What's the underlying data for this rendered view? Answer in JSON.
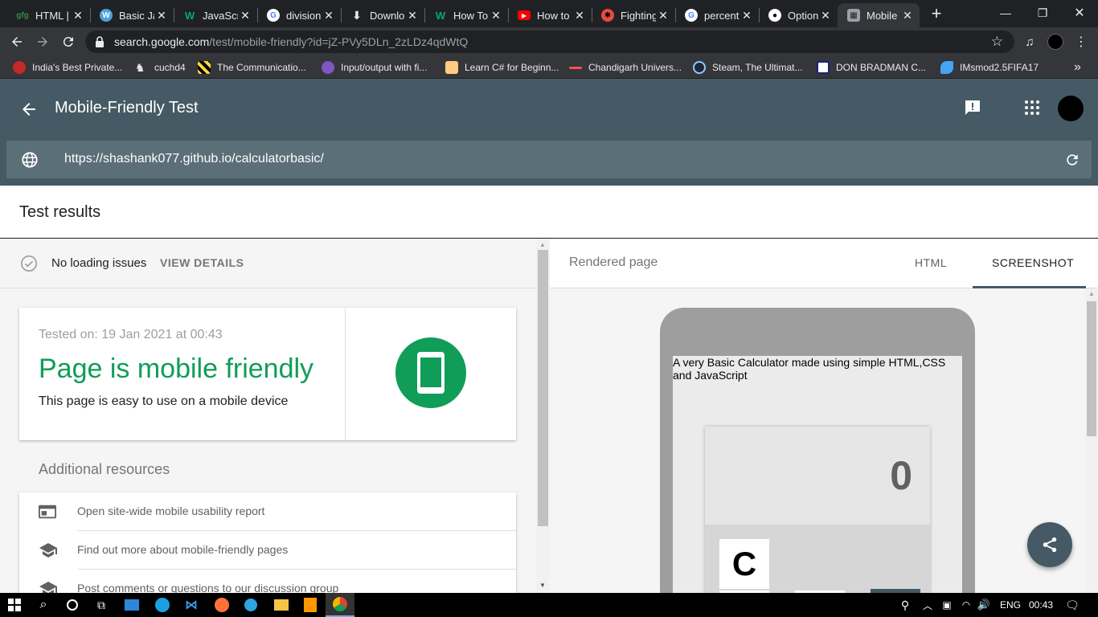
{
  "browser": {
    "tabs": [
      {
        "title": "HTML |",
        "fav": "gfg-icon",
        "color": "#2f8d46"
      },
      {
        "title": "Basic Ja",
        "fav": "w3-icon",
        "color": "#4aa3df"
      },
      {
        "title": "JavaScr",
        "fav": "w3schools-icon",
        "color": "#04aa6d"
      },
      {
        "title": "division",
        "fav": "google-icon",
        "color": "#ffffff"
      },
      {
        "title": "Downlo",
        "fav": "download-icon",
        "color": "#e8eaed"
      },
      {
        "title": "How To",
        "fav": "w3schools-icon",
        "color": "#04aa6d"
      },
      {
        "title": "How to",
        "fav": "youtube-icon",
        "color": "#ff0000"
      },
      {
        "title": "Fighting",
        "fav": "fight-icon",
        "color": "#e94b3c"
      },
      {
        "title": "percent",
        "fav": "google-icon",
        "color": "#ffffff"
      },
      {
        "title": "Option",
        "fav": "github-icon",
        "color": "#ffffff"
      },
      {
        "title": "Mobile",
        "fav": "search-console-icon",
        "color": "#9aa0a6"
      }
    ],
    "new_tab": "+",
    "url_host": "search.google.com",
    "url_path": "/test/mobile-friendly?id=jZ-PVy5DLn_2zLDz4qdWtQ",
    "bookmarks": [
      {
        "label": "India's Best Private...",
        "color": "#c62828"
      },
      {
        "label": "cuchd4",
        "color": "#e8eaed"
      },
      {
        "label": "The Communicatio...",
        "color": "#fdd835"
      },
      {
        "label": "Input/output with fi...",
        "color": "#7e57c2"
      },
      {
        "label": "Learn C# for Beginn...",
        "color": "#ffcc80"
      },
      {
        "label": "Chandigarh Univers...",
        "color": "#ef5350"
      },
      {
        "label": "Steam, The Ultimat...",
        "color": "#90caf9"
      },
      {
        "label": "DON BRADMAN C...",
        "color": "#e8eaed"
      },
      {
        "label": "IMsmod2.5FIFA17",
        "color": "#42a5f5"
      }
    ]
  },
  "app": {
    "title": "Mobile-Friendly Test",
    "tested_url": "https://shashank077.github.io/calculatorbasic/",
    "header_color": "#455a64"
  },
  "results": {
    "title": "Test results",
    "loading_status": "No loading issues",
    "view_details": "VIEW DETAILS",
    "tested_on": "Tested on: 19 Jan 2021 at 00:43",
    "verdict": "Page is mobile friendly",
    "verdict_sub": "This page is easy to use on a mobile device",
    "verdict_color": "#0f9d58",
    "additional_title": "Additional resources",
    "resources": [
      {
        "label": "Open site-wide mobile usability report",
        "icon": "report-icon"
      },
      {
        "label": "Find out more about mobile-friendly pages",
        "icon": "school-icon"
      },
      {
        "label": "Post comments or questions to our discussion group",
        "icon": "school-icon"
      }
    ]
  },
  "rendered": {
    "title": "Rendered page",
    "tabs": [
      "HTML",
      "SCREENSHOT"
    ],
    "active_tab": "SCREENSHOT",
    "page_text": "A very Basic Calculator made using simple HTML,CSS and JavaScript",
    "calc_display": "0",
    "calc_clear": "C"
  },
  "taskbar": {
    "language": "ENG",
    "time": "00:43"
  }
}
